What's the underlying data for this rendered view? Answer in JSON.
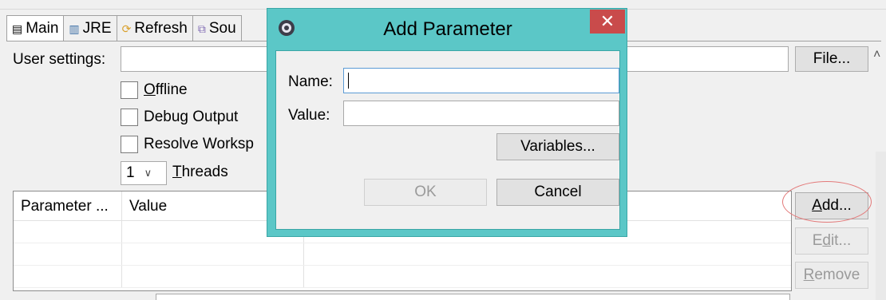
{
  "tabs": [
    {
      "label": "Main",
      "icon": "document-icon",
      "active": true
    },
    {
      "label": "JRE",
      "icon": "library-icon"
    },
    {
      "label": "Refresh",
      "icon": "refresh-icon"
    },
    {
      "label": "Sou",
      "icon": "source-icon"
    }
  ],
  "main": {
    "user_settings_label": "User settings:",
    "user_settings_value": "",
    "file_button": "File...",
    "offline_label_prefix": "",
    "offline_label_ul": "O",
    "offline_label_rest": "ffline",
    "debug_label_prefix": "Debu",
    "debug_label_ul": "g",
    "debug_label_rest": " Output",
    "resolve_label": "Resolve Worksp",
    "threads_value": "1",
    "threads_label_ul": "T",
    "threads_label_rest": "hreads"
  },
  "parameters_table": {
    "columns": [
      "Parameter ...",
      "Value"
    ],
    "rows": []
  },
  "side_buttons": {
    "add_ul": "A",
    "add_rest": "dd...",
    "edit_prefix": "E",
    "edit_ul": "d",
    "edit_rest": "it...",
    "remove_ul": "R",
    "remove_rest": "emove"
  },
  "dialog": {
    "title": "Add Parameter",
    "close_glyph": "✕",
    "name_label": "Name:",
    "name_value": "",
    "value_label": "Value:",
    "value_value": "",
    "variables_button": "Variables...",
    "ok_button": "OK",
    "cancel_button": "Cancel"
  },
  "colors": {
    "dialog_frame": "#5bc7c7",
    "close_button": "#c94b4b",
    "highlight_oval": "#e37a7a"
  }
}
